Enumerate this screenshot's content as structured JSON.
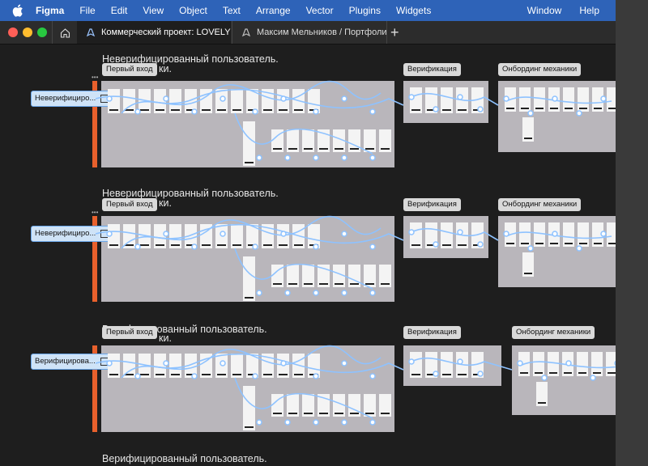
{
  "menubar": {
    "app": "Figma",
    "items": [
      "File",
      "Edit",
      "View",
      "Object",
      "Text",
      "Arrange",
      "Vector",
      "Plugins",
      "Widgets"
    ],
    "right_items": [
      "Window",
      "Help"
    ]
  },
  "tabs": [
    {
      "label": "Коммерческий проект: LOVELY",
      "active": true
    },
    {
      "label": "Максим Мельников / Портфолио (Cт",
      "active": false
    }
  ],
  "sections": [
    {
      "title_line1": "Неверифицированный пользователь.",
      "title_line2": "ки.",
      "first_label": "Первый вход",
      "verif_label": "Верификация",
      "onboard_label": "Онбординг механики",
      "flow_label": "Неверифициро..."
    },
    {
      "title_line1": "Неверифицированный пользователь.",
      "title_line2": "ки.",
      "first_label": "Первый вход",
      "verif_label": "Верификация",
      "onboard_label": "Онбординг механики",
      "flow_label": "Неверифициро..."
    },
    {
      "title_line1": "Верифицированный пользователь.",
      "title_line2": "ки.",
      "first_label": "Первый вход",
      "verif_label": "Верификация",
      "onboard_label": "Онбординг механики",
      "flow_label": "Верифицирова..."
    }
  ],
  "bottom_title": "Верифицированный пользователь.",
  "colors": {
    "menubar": "#2e63b8",
    "accent_orange": "#e8602c",
    "frame_bg": "#b9b6bb",
    "flow_line": "#8ec2ff"
  }
}
